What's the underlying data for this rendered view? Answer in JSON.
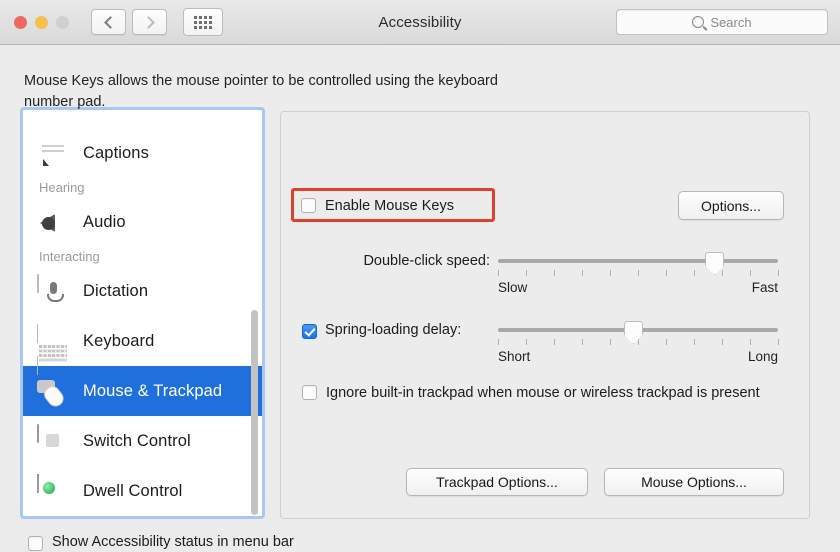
{
  "window": {
    "title": "Accessibility",
    "traffic_lights": [
      "close-button",
      "minimize-button",
      "zoom-button"
    ],
    "nav": {
      "back": "back-button",
      "forward": "forward-button",
      "show_all": "show-all-button"
    },
    "search": {
      "placeholder": "Search",
      "value": ""
    }
  },
  "sidebar": {
    "items": [
      {
        "type": "item",
        "label": "Captions",
        "icon": "captions-icon",
        "selected": false
      },
      {
        "type": "group",
        "label": "Hearing"
      },
      {
        "type": "item",
        "label": "Audio",
        "icon": "audio-icon",
        "selected": false
      },
      {
        "type": "group",
        "label": "Interacting"
      },
      {
        "type": "item",
        "label": "Dictation",
        "icon": "dictation-icon",
        "selected": false
      },
      {
        "type": "item",
        "label": "Keyboard",
        "icon": "keyboard-icon",
        "selected": false
      },
      {
        "type": "item",
        "label": "Mouse & Trackpad",
        "icon": "mouse-trackpad-icon",
        "selected": true
      },
      {
        "type": "item",
        "label": "Switch Control",
        "icon": "switch-control-icon",
        "selected": false
      },
      {
        "type": "item",
        "label": "Dwell Control",
        "icon": "dwell-control-icon",
        "selected": false
      }
    ],
    "selected_color": "#1f6fdd",
    "focus_ring_color": "#a8c8f0"
  },
  "main": {
    "description": "Mouse Keys allows the mouse pointer to be controlled using the keyboard number pad.",
    "enable_mouse_keys": {
      "label": "Enable Mouse Keys",
      "checked": false,
      "highlight_color": "#e1412c"
    },
    "options_button": "Options...",
    "double_click": {
      "label": "Double-click speed:",
      "min_label": "Slow",
      "max_label": "Fast",
      "value_percent": 77,
      "tick_count": 11
    },
    "spring_loading": {
      "label": "Spring-loading delay:",
      "checked": true,
      "min_label": "Short",
      "max_label": "Long",
      "value_percent": 48,
      "tick_count": 11
    },
    "ignore_trackpad": {
      "label": "Ignore built-in trackpad when mouse or wireless trackpad is present",
      "checked": false
    },
    "trackpad_options_button": "Trackpad Options...",
    "mouse_options_button": "Mouse Options..."
  },
  "footer": {
    "show_status_label": "Show Accessibility status in menu bar",
    "checked": false
  }
}
